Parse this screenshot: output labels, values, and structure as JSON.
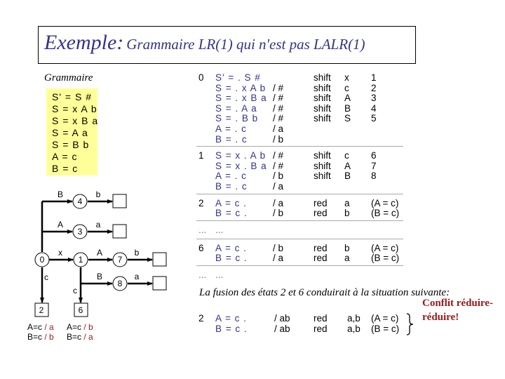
{
  "title": {
    "main": "Exemple:",
    "sub": "Grammaire LR(1) qui n'est pas LALR(1)"
  },
  "grammar": {
    "label": "Grammaire",
    "rules": [
      "S' = S #",
      "S = x A b",
      "S = x B a",
      "S = A a",
      "S = B b",
      "A = c",
      "B = c"
    ],
    "bg_color": "#ffff99"
  },
  "automaton": {
    "states": [
      "0",
      "1",
      "2",
      "3",
      "4",
      "6",
      "7",
      "8"
    ],
    "edge_labels": {
      "e0_4": "B",
      "e4_out": "b",
      "e0_3": "A",
      "e3_out": "a",
      "e0_1": "x",
      "e1_7": "A",
      "e7_out": "b",
      "e1_8": "B",
      "e8_out": "a",
      "e0_2": "c",
      "e1_6": "c"
    },
    "state2_items": [
      {
        "prod": "A=c",
        "sep": " / ",
        "la": "a"
      },
      {
        "prod": "B=c",
        "sep": " / ",
        "la": "b"
      }
    ],
    "state6_items": [
      {
        "prod": "A=c",
        "sep": " / ",
        "la": "b"
      },
      {
        "prod": "B=c",
        "sep": " / ",
        "la": "a"
      }
    ]
  },
  "table": {
    "blocks": [
      {
        "state": "0",
        "rows": [
          {
            "item": "S' = . S #",
            "la": "",
            "action": "shift",
            "sym": "x",
            "target": "1"
          },
          {
            "item": "S = . x A b",
            "la": "/ #",
            "action": "shift",
            "sym": "c",
            "target": "2"
          },
          {
            "item": "S = . x B a",
            "la": "/ #",
            "action": "shift",
            "sym": "A",
            "target": "3"
          },
          {
            "item": "S = . A a",
            "la": "/ #",
            "action": "shift",
            "sym": "B",
            "target": "4"
          },
          {
            "item": "S = . B b",
            "la": "/ #",
            "action": "shift",
            "sym": "S",
            "target": "5"
          },
          {
            "item": "A = . c",
            "la": "/ a",
            "action": "",
            "sym": "",
            "target": ""
          },
          {
            "item": "B = . c",
            "la": "/ b",
            "action": "",
            "sym": "",
            "target": ""
          }
        ]
      },
      {
        "state": "1",
        "rows": [
          {
            "item": "S = x . A b",
            "la": "/ #",
            "action": "shift",
            "sym": "c",
            "target": "6"
          },
          {
            "item": "S = x . B a",
            "la": "/ #",
            "action": "shift",
            "sym": "A",
            "target": "7"
          },
          {
            "item": "A = . c",
            "la": "/ b",
            "action": "shift",
            "sym": "B",
            "target": "8"
          },
          {
            "item": "B = . c",
            "la": "/ a",
            "action": "",
            "sym": "",
            "target": ""
          }
        ]
      },
      {
        "state": "2",
        "rows": [
          {
            "item": "A = c .",
            "la": "/ a",
            "action": "red",
            "sym": "a",
            "target": "(A = c)"
          },
          {
            "item": "B = c .",
            "la": "/ b",
            "action": "red",
            "sym": "b",
            "target": "(B = c)"
          }
        ]
      },
      {
        "state": "...",
        "ellipsis": "...",
        "rows": []
      },
      {
        "state": "6",
        "rows": [
          {
            "item": "A = c .",
            "la": "/ b",
            "action": "red",
            "sym": "b",
            "target": "(A = c)"
          },
          {
            "item": "B = c .",
            "la": "/ a",
            "action": "red",
            "sym": "a",
            "target": "(B = c)"
          }
        ]
      },
      {
        "state": "...",
        "ellipsis": "...",
        "rows": []
      }
    ]
  },
  "fusion": {
    "text": "La fusion des états 2 et 6 conduirait à la situation suivante:",
    "state": "2",
    "rows": [
      {
        "item": "A = c .",
        "la": "/ ab",
        "action": "red",
        "sym": "a,b",
        "target": "(A = c)"
      },
      {
        "item": "B = c .",
        "la": "/ ab",
        "action": "red",
        "sym": "a,b",
        "target": "(B = c)"
      }
    ],
    "conflict_line1": "Conflit réduire-",
    "conflict_line2": "réduire!",
    "conflict_color": "#a01818"
  }
}
